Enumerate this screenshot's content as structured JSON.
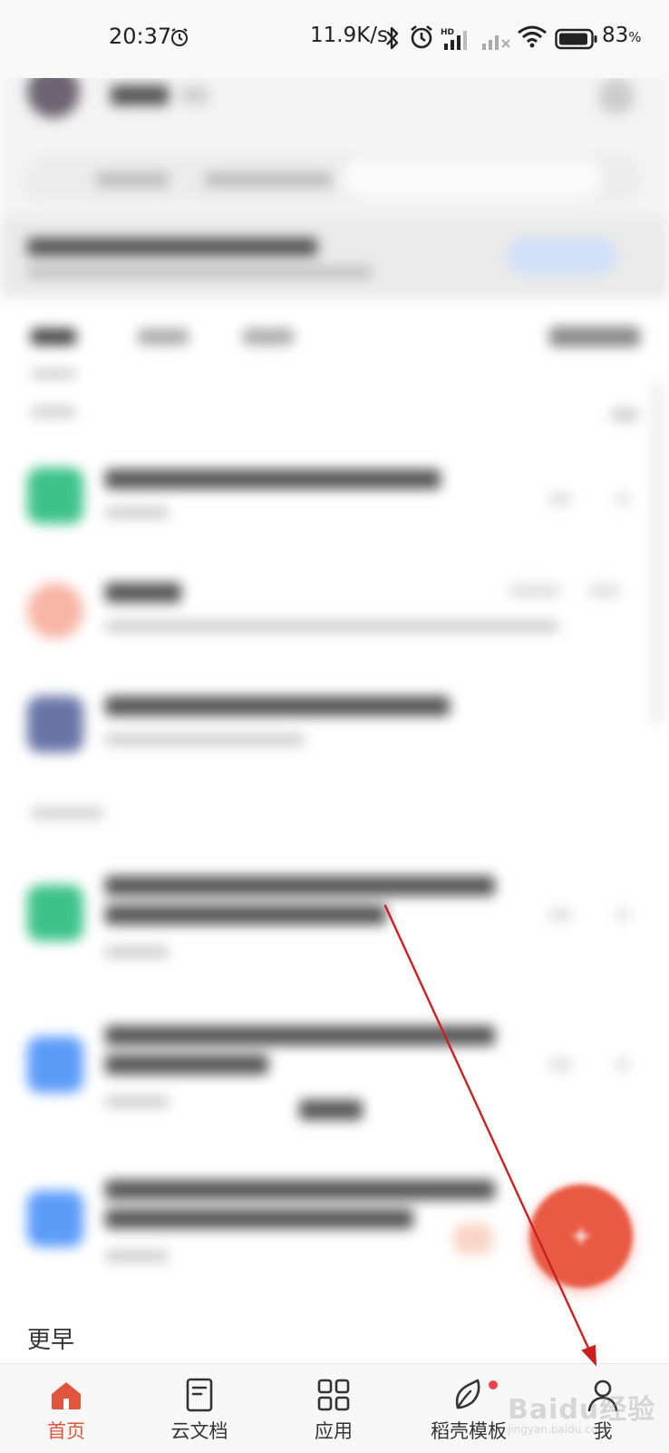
{
  "status_bar": {
    "time": "20:37",
    "network_speed": "11.9K/s",
    "battery_level": "83",
    "battery_unit": "%",
    "icons": [
      "alarm-icon",
      "bluetooth-icon",
      "alarm-icon",
      "hd-signal-icon",
      "signal-icon",
      "wifi-icon",
      "battery-icon"
    ]
  },
  "section_partial": {
    "label": "更早"
  },
  "bottom_nav": {
    "active_index": 0,
    "accent_color": "#e0553e",
    "items": [
      {
        "label": "首页",
        "icon": "home-icon"
      },
      {
        "label": "云文档",
        "icon": "document-icon"
      },
      {
        "label": "应用",
        "icon": "apps-grid-icon"
      },
      {
        "label": "稻壳模板",
        "icon": "leaf-icon",
        "badge": true
      },
      {
        "label": "我",
        "icon": "profile-icon"
      }
    ]
  },
  "fab": {
    "color": "#e95a44",
    "icon": "plus-icon"
  },
  "annotation": {
    "arrow_color": "#cc1f1f"
  },
  "watermark": {
    "logo": "Baidu经验",
    "url": "jingyan.baidu.com"
  }
}
